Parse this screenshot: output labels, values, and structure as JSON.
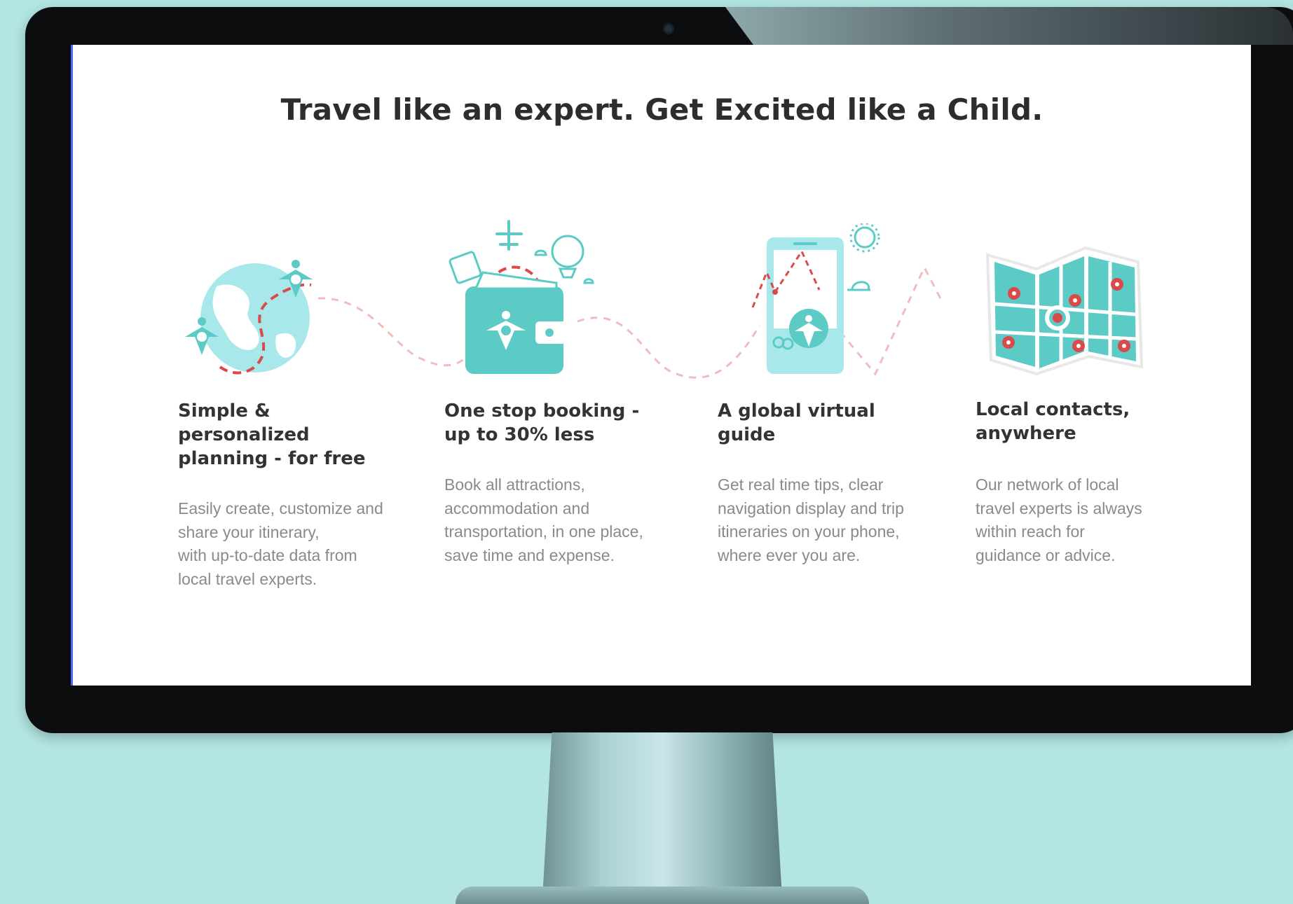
{
  "page": {
    "headline": "Travel like an expert. Get Excited like a Child."
  },
  "features": [
    {
      "icon": "globe-icon",
      "title": "Simple & personalized planning - for free",
      "description": "Easily create, customize and\nshare your itinerary,\nwith up-to-date data from\nlocal travel experts."
    },
    {
      "icon": "wallet-icon",
      "title": "One stop booking -\nup to 30% less",
      "description": "Book all attractions,\naccommodation and\ntransportation,  in one place,\nsave time and expense."
    },
    {
      "icon": "phone-icon",
      "title": "A global virtual\nguide",
      "description": "Get real time tips, clear\nnavigation display and trip\nitineraries on your phone,\nwhere ever you are."
    },
    {
      "icon": "map-icon",
      "title": "Local contacts,\nanywhere",
      "description": "Our network of local\ntravel experts is always\nwithin reach for\nguidance or advice."
    }
  ],
  "colors": {
    "accent": "#5ccbc6",
    "accent_light": "#a9e8ea",
    "path": "#f0bcbc",
    "marker_red": "#d94a4a",
    "heading": "#2d2d2d",
    "body": "#8a8a8a",
    "background": "#b3e6e3"
  }
}
